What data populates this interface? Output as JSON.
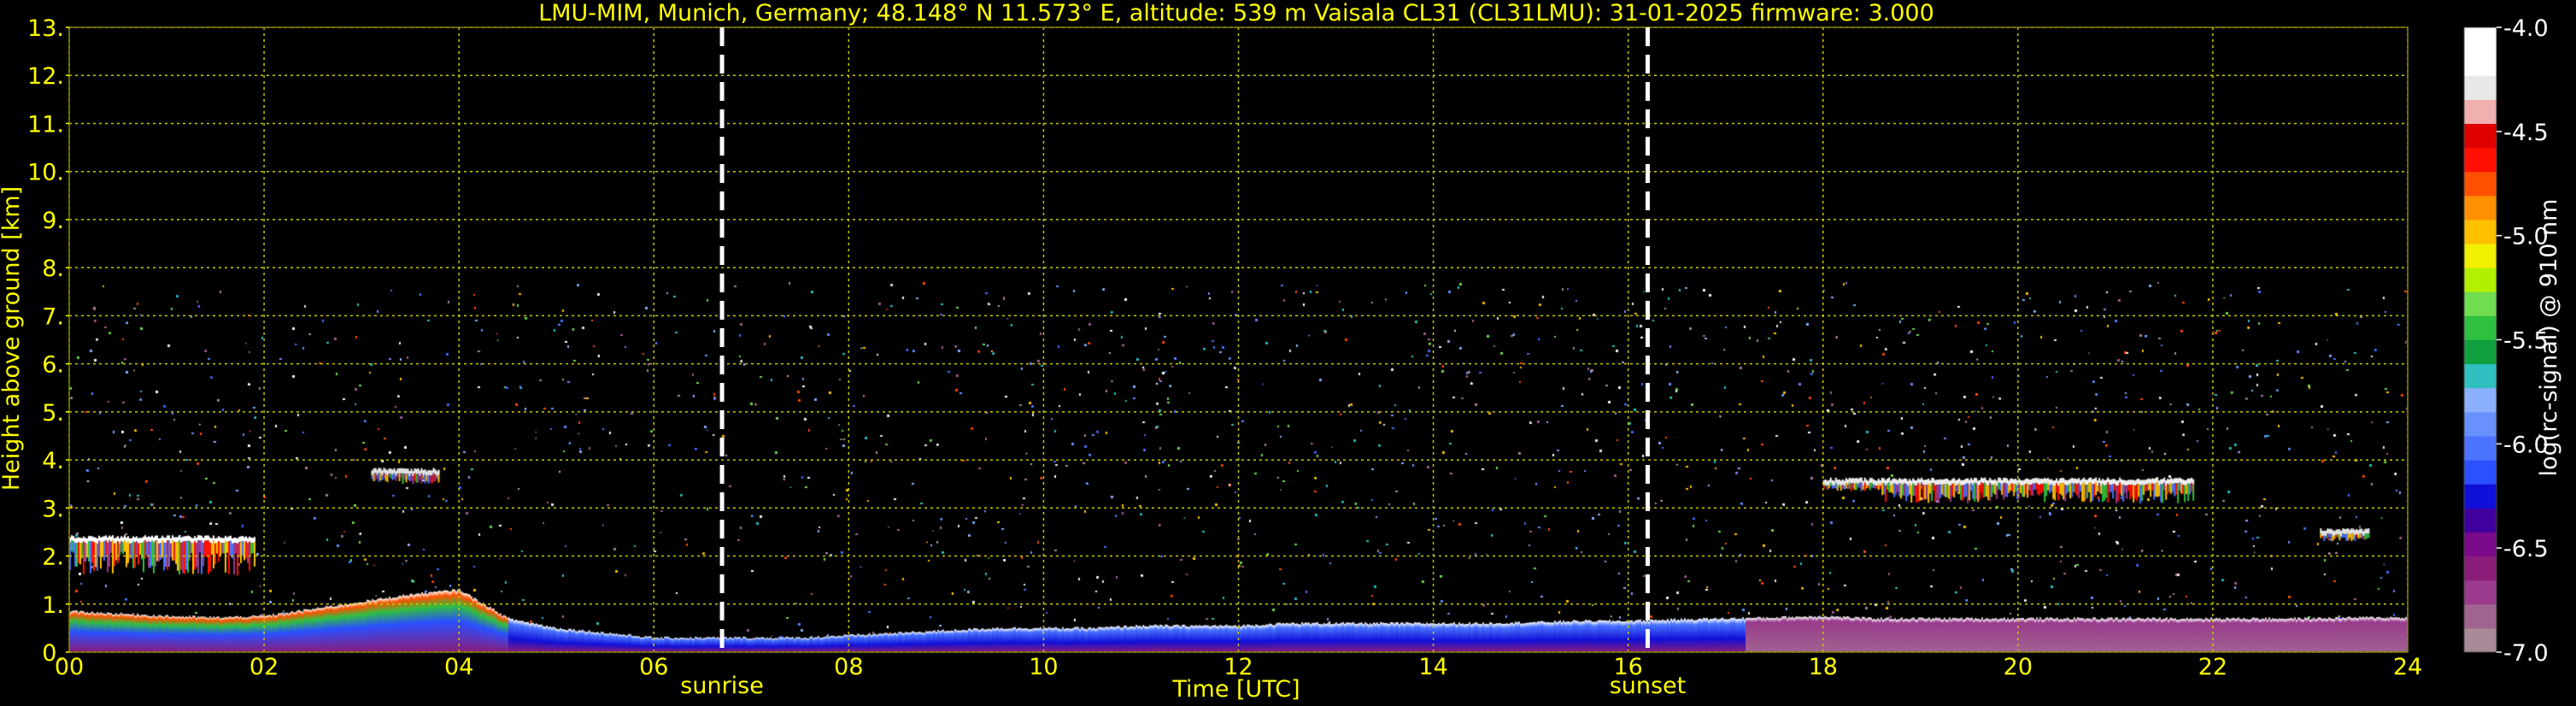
{
  "chart_data": {
    "type": "heatmap",
    "title": "LMU-MIM, Munich, Germany; 48.148° N 11.573° E, altitude: 539 m    Vaisala CL31 (CL31LMU): 31-01-2025    firmware: 3.000",
    "xlabel": "Time [UTC]",
    "ylabel": "Height above ground [km]",
    "xlim": [
      0,
      24
    ],
    "ylim": [
      0,
      13
    ],
    "x_ticks": [
      "00",
      "02",
      "04",
      "06",
      "08",
      "10",
      "12",
      "14",
      "16",
      "18",
      "20",
      "22",
      "24"
    ],
    "y_ticks": [
      "0.",
      "1.",
      "2.",
      "3.",
      "4.",
      "5.",
      "6.",
      "7.",
      "8.",
      "9.",
      "10.",
      "11.",
      "12.",
      "13."
    ],
    "grid": true,
    "max_range_km": 7.7,
    "events": [
      {
        "label": "sunrise",
        "time": 6.7
      },
      {
        "label": "sunset",
        "time": 16.2
      }
    ],
    "boundary_layer_top": {
      "time": [
        0,
        0.5,
        1,
        1.5,
        2,
        2.5,
        3,
        3.5,
        4,
        4.5,
        5,
        5.5,
        6,
        6.5,
        7,
        7.5,
        8,
        8.5,
        9,
        9.5,
        10,
        10.5,
        11,
        11.5,
        12,
        12.5,
        13,
        13.5,
        14,
        14.5,
        15,
        15.5,
        16,
        16.5,
        17,
        17.5,
        18,
        18.5,
        19,
        19.5,
        20,
        20.5,
        21,
        21.5,
        22,
        22.5,
        23,
        23.5,
        24
      ],
      "height": [
        0.85,
        0.8,
        0.75,
        0.72,
        0.75,
        0.9,
        1.05,
        1.2,
        1.3,
        0.7,
        0.5,
        0.4,
        0.3,
        0.3,
        0.3,
        0.3,
        0.35,
        0.4,
        0.45,
        0.5,
        0.5,
        0.5,
        0.55,
        0.55,
        0.55,
        0.6,
        0.6,
        0.6,
        0.6,
        0.6,
        0.62,
        0.65,
        0.65,
        0.68,
        0.7,
        0.72,
        0.75,
        0.7,
        0.7,
        0.7,
        0.7,
        0.7,
        0.7,
        0.7,
        0.7,
        0.7,
        0.7,
        0.72,
        0.72
      ]
    },
    "cloud_layers": [
      {
        "t_start": 0.0,
        "t_end": 1.9,
        "base_km": 1.7,
        "top_km": 2.4
      },
      {
        "t_start": 3.1,
        "t_end": 3.8,
        "base_km": 3.6,
        "top_km": 3.8
      },
      {
        "t_start": 18.0,
        "t_end": 18.6,
        "base_km": 3.45,
        "top_km": 3.6
      },
      {
        "t_start": 18.6,
        "t_end": 21.8,
        "base_km": 3.2,
        "top_km": 3.6
      },
      {
        "t_start": 23.1,
        "t_end": 23.6,
        "base_km": 2.4,
        "top_km": 2.55
      }
    ],
    "colorbar": {
      "label": "log(rc-signal) @ 910 nm",
      "min": -7.0,
      "max": -4.0,
      "ticks": [
        "-4.0",
        "-4.5",
        "-5.0",
        "-5.5",
        "-6.0",
        "-6.5",
        "-7.0"
      ],
      "colors": [
        "#a88a98",
        "#a06490",
        "#9a3a8c",
        "#8c1c7a",
        "#7a0a8a",
        "#4000a0",
        "#1010d8",
        "#2a50ff",
        "#4a74ff",
        "#6890ff",
        "#8ab0ff",
        "#30c0c0",
        "#10a040",
        "#30c040",
        "#70dc50",
        "#b0f000",
        "#f0f000",
        "#ffc000",
        "#ff9000",
        "#ff5000",
        "#ff1000",
        "#e00000",
        "#f0b0b0",
        "#e8e8e8",
        "#ffffff",
        "#ffffff"
      ]
    }
  }
}
